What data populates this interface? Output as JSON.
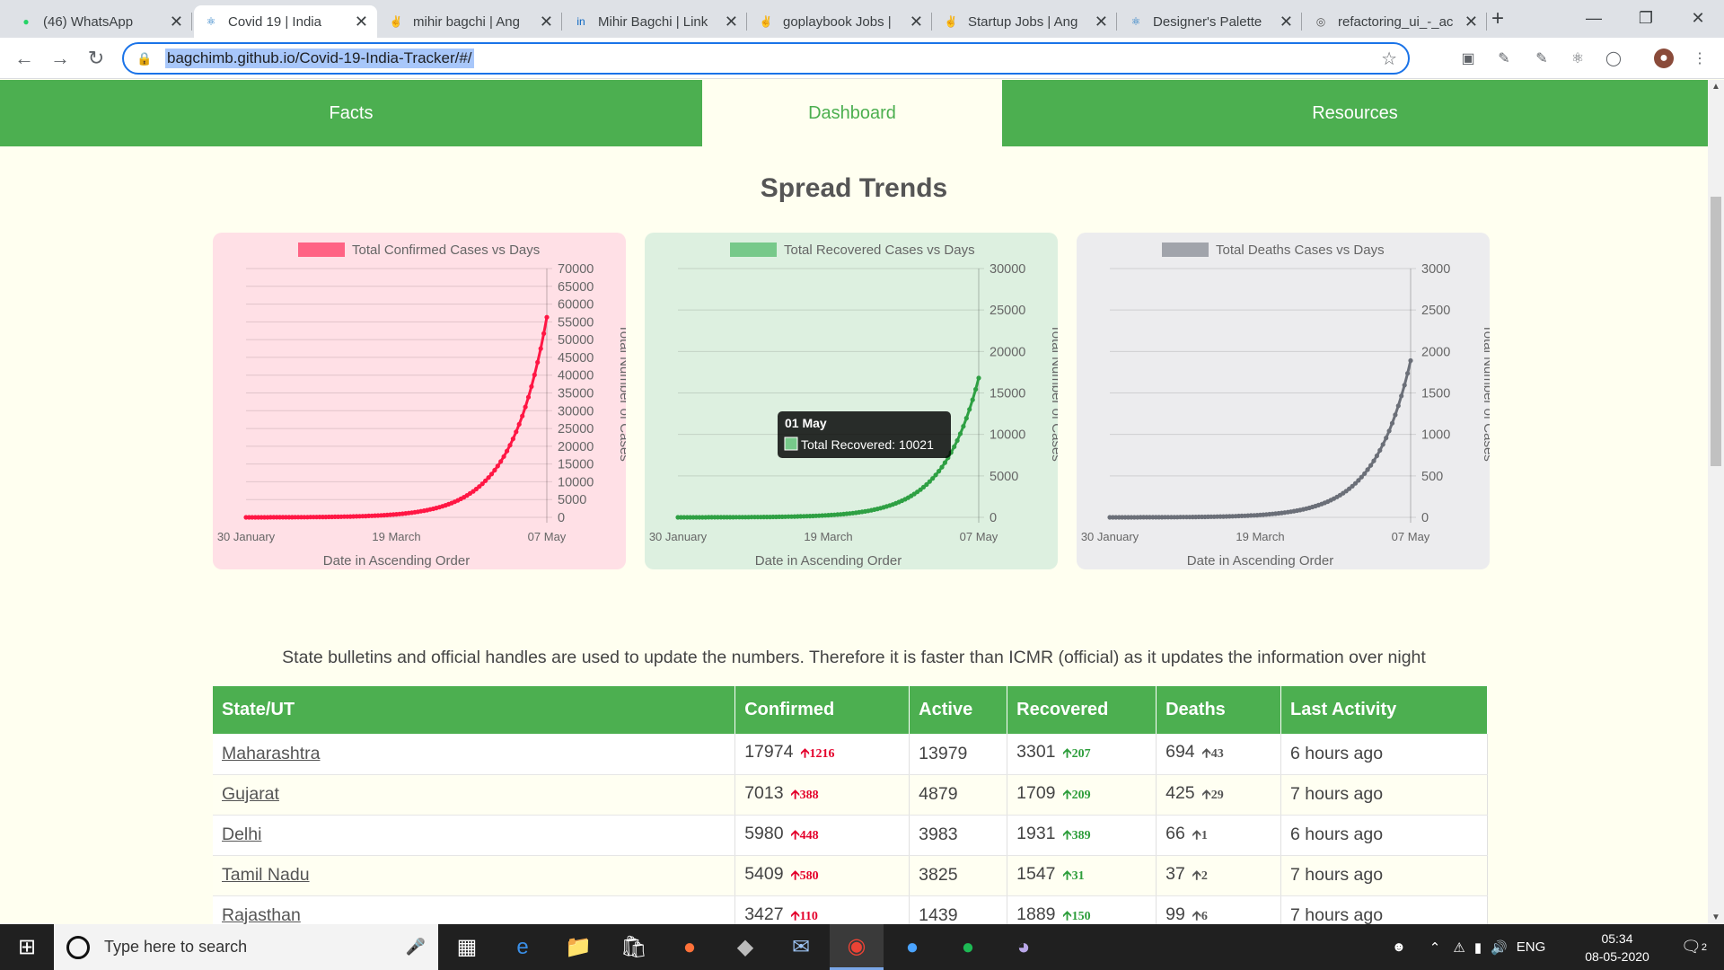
{
  "browser": {
    "tabs": [
      {
        "label": "(46) WhatsApp",
        "icon": "whatsapp-icon",
        "active": false
      },
      {
        "label": "Covid 19 | India",
        "icon": "react-icon",
        "active": true
      },
      {
        "label": "mihir bagchi | Ang",
        "icon": "angellist-icon",
        "active": false
      },
      {
        "label": "Mihir Bagchi | Link",
        "icon": "linkedin-icon",
        "active": false
      },
      {
        "label": "goplaybook Jobs |",
        "icon": "angellist-icon",
        "active": false
      },
      {
        "label": "Startup Jobs | Ang",
        "icon": "angellist-icon",
        "active": false
      },
      {
        "label": "Designer's Palette",
        "icon": "react-icon",
        "active": false
      },
      {
        "label": "refactoring_ui_-_ac",
        "icon": "globe-icon",
        "active": false
      }
    ],
    "url": "bagchimb.github.io/Covid-19-India-Tracker/#/"
  },
  "nav": {
    "items": [
      "Facts",
      "Dashboard",
      "Resources"
    ],
    "active": "Dashboard"
  },
  "section_title": "Spread Trends",
  "chart_data": [
    {
      "type": "line",
      "title": "Total Confirmed Cases vs Days",
      "series_color": "#ff1744",
      "bg": "#ffe0e6",
      "legend_color": "#ff6384",
      "xlabel": "Date in Ascending Order",
      "ylabel": "Total Number of Cases",
      "x_ticks": [
        "30 January",
        "19 March",
        "07 May"
      ],
      "y_ticks": [
        0,
        5000,
        10000,
        15000,
        20000,
        25000,
        30000,
        35000,
        40000,
        45000,
        50000,
        55000,
        60000,
        65000,
        70000
      ],
      "ylim": [
        0,
        70000
      ],
      "end_value": 56300
    },
    {
      "type": "line",
      "title": "Total Recovered Cases vs Days",
      "series_color": "#2ea043",
      "bg": "#ddf0e0",
      "legend_color": "#77c98a",
      "xlabel": "Date in Ascending Order",
      "ylabel": "Total Number of Cases",
      "x_ticks": [
        "30 January",
        "19 March",
        "07 May"
      ],
      "y_ticks": [
        0,
        5000,
        10000,
        15000,
        20000,
        25000,
        30000
      ],
      "ylim": [
        0,
        30000
      ],
      "end_value": 16800,
      "tooltip": {
        "date": "01 May",
        "label": "Total Recovered: 10021"
      }
    },
    {
      "type": "line",
      "title": "Total Deaths Cases vs Days",
      "series_color": "#6b6f78",
      "bg": "#ececee",
      "legend_color": "#a1a4ab",
      "xlabel": "Date in Ascending Order",
      "ylabel": "Total Number of Cases",
      "x_ticks": [
        "30 January",
        "19 March",
        "07 May"
      ],
      "y_ticks": [
        0,
        500,
        1000,
        1500,
        2000,
        2500,
        3000
      ],
      "ylim": [
        0,
        3000
      ],
      "end_value": 1890
    }
  ],
  "note": "State bulletins and official handles are used to update the numbers. Therefore it is faster than ICMR (official) as it updates the information over night",
  "table": {
    "headers": [
      "State/UT",
      "Confirmed",
      "Active",
      "Recovered",
      "Deaths",
      "Last Activity"
    ],
    "rows": [
      {
        "state": "Maharashtra",
        "confirmed": "17974",
        "confirmed_delta": "1216",
        "active": "13979",
        "recovered": "3301",
        "recovered_delta": "207",
        "deaths": "694",
        "deaths_delta": "43",
        "last": "6 hours ago"
      },
      {
        "state": "Gujarat",
        "confirmed": "7013",
        "confirmed_delta": "388",
        "active": "4879",
        "recovered": "1709",
        "recovered_delta": "209",
        "deaths": "425",
        "deaths_delta": "29",
        "last": "7 hours ago"
      },
      {
        "state": "Delhi",
        "confirmed": "5980",
        "confirmed_delta": "448",
        "active": "3983",
        "recovered": "1931",
        "recovered_delta": "389",
        "deaths": "66",
        "deaths_delta": "1",
        "last": "6 hours ago"
      },
      {
        "state": "Tamil Nadu",
        "confirmed": "5409",
        "confirmed_delta": "580",
        "active": "3825",
        "recovered": "1547",
        "recovered_delta": "31",
        "deaths": "37",
        "deaths_delta": "2",
        "last": "7 hours ago"
      },
      {
        "state": "Rajasthan",
        "confirmed": "3427",
        "confirmed_delta": "110",
        "active": "1439",
        "recovered": "1889",
        "recovered_delta": "150",
        "deaths": "99",
        "deaths_delta": "6",
        "last": "7 hours ago"
      }
    ]
  },
  "taskbar": {
    "search_placeholder": "Type here to search",
    "language": "ENG",
    "time": "05:34",
    "date": "08-05-2020",
    "notifications": "2"
  }
}
